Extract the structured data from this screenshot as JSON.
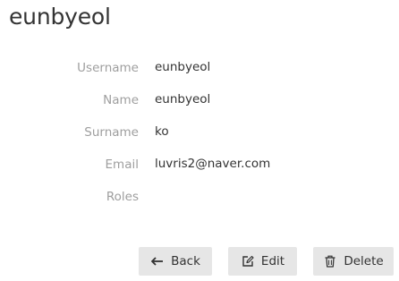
{
  "page": {
    "title": "eunbyeol"
  },
  "fields": [
    {
      "label": "Username",
      "value": "eunbyeol"
    },
    {
      "label": "Name",
      "value": "eunbyeol"
    },
    {
      "label": "Surname",
      "value": "ko"
    },
    {
      "label": "Email",
      "value": "luvris2@naver.com"
    },
    {
      "label": "Roles",
      "value": ""
    }
  ],
  "actions": {
    "back_label": "Back",
    "edit_label": "Edit",
    "delete_label": "Delete",
    "back_icon": "arrow-left-icon",
    "edit_icon": "edit-icon",
    "delete_icon": "trash-icon"
  },
  "colors": {
    "label": "#9e9e9e",
    "text": "#333333",
    "button_bg": "#e6e6e6"
  }
}
